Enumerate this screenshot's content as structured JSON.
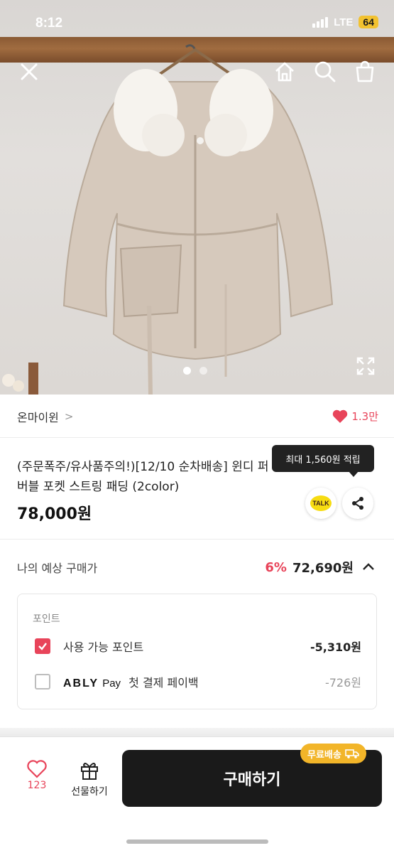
{
  "status_bar": {
    "time": "8:12",
    "network": "LTE",
    "battery": "64"
  },
  "hero": {
    "image_alt": "product-coat-photo",
    "carousel": {
      "total": 2,
      "active_index": 0
    },
    "icons": [
      "close-icon",
      "home-icon",
      "search-icon",
      "shopping-bag-icon",
      "expand-icon"
    ]
  },
  "store": {
    "name": "온마이윈",
    "chevron": ">",
    "likes": "1.3만"
  },
  "product": {
    "title": "(주문폭주/유사품주의!)[12/10 순차배송] 윈디 퍼 버블 포켓 스트링 패딩 (2color)",
    "price": "78,000원",
    "tooltip": "최대 1,560원 적립",
    "talk_label": "TALK"
  },
  "expected_price": {
    "label": "나의 예상 구매가",
    "discount": "6%",
    "price": "72,690원"
  },
  "points": {
    "title": "포인트",
    "rows": [
      {
        "label": "사용 가능 포인트",
        "value": "-5,310원",
        "checked": true
      },
      {
        "brand": "ABLY",
        "brand_suffix": "Pay",
        "label": "첫 결제 페이백",
        "value": "-726원",
        "checked": false
      }
    ]
  },
  "bottom_bar": {
    "wish_count": "123",
    "gift_label": "선물하기",
    "buy_label": "구매하기",
    "shipping_badge": "무료배송"
  },
  "colors": {
    "accent": "#e8445a",
    "buy_button": "#1a1a1a",
    "badge": "#f2b529"
  }
}
